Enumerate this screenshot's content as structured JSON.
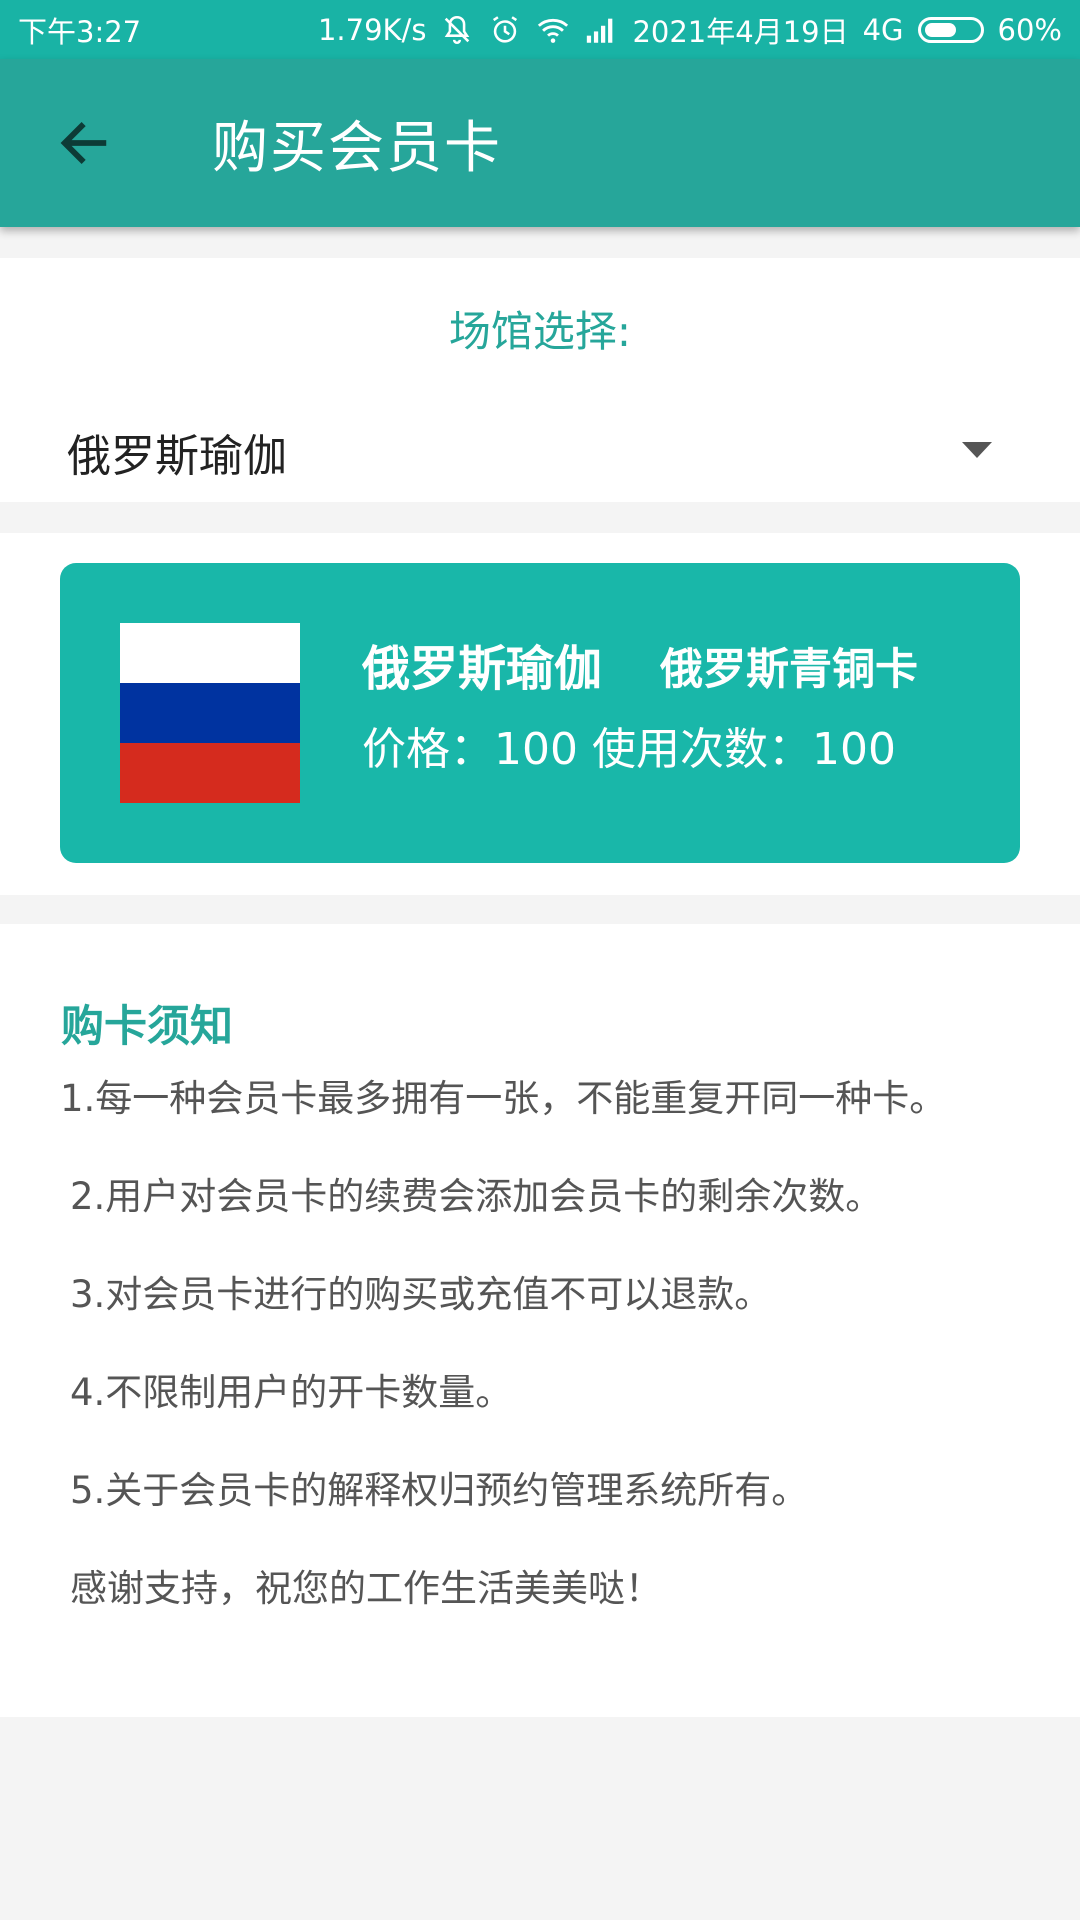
{
  "status_bar": {
    "time": "下午3:27",
    "network_speed": "1.79K/s",
    "date": "2021年4月19日",
    "network_type": "4G",
    "battery_percent": "60%",
    "battery_level": 0.6,
    "icons": [
      "bell-muted-icon",
      "alarm-icon",
      "wifi-icon",
      "signal-icon",
      "battery-icon"
    ]
  },
  "app_bar": {
    "title": "购买会员卡",
    "back_icon": "arrow-left-icon"
  },
  "venue": {
    "label": "场馆选择:",
    "selected": "俄罗斯瑜伽",
    "dropdown_icon": "caret-down-icon"
  },
  "card": {
    "venue_name": "俄罗斯瑜伽",
    "card_type": "俄罗斯青铜卡",
    "price_text": "价格：100",
    "uses_text": "使用次数：100",
    "flag_colors": [
      "#ffffff",
      "#0033a0",
      "#d52b1e"
    ]
  },
  "notice": {
    "title": "购卡须知",
    "items": [
      "1.每一种会员卡最多拥有一张，不能重复开同一种卡。",
      "2.用户对会员卡的续费会添加会员卡的剩余次数。",
      "3.对会员卡进行的购买或充值不可以退款。",
      "4.不限制用户的开卡数量。",
      "5.关于会员卡的解释权归预约管理系统所有。",
      "感谢支持，祝您的工作生活美美哒！"
    ]
  },
  "colors": {
    "status_bar": "#19b3a5",
    "app_bar": "#26a69a",
    "accent": "#26a69a",
    "card": "#19b7a9",
    "page_bg": "#f4f4f4"
  }
}
